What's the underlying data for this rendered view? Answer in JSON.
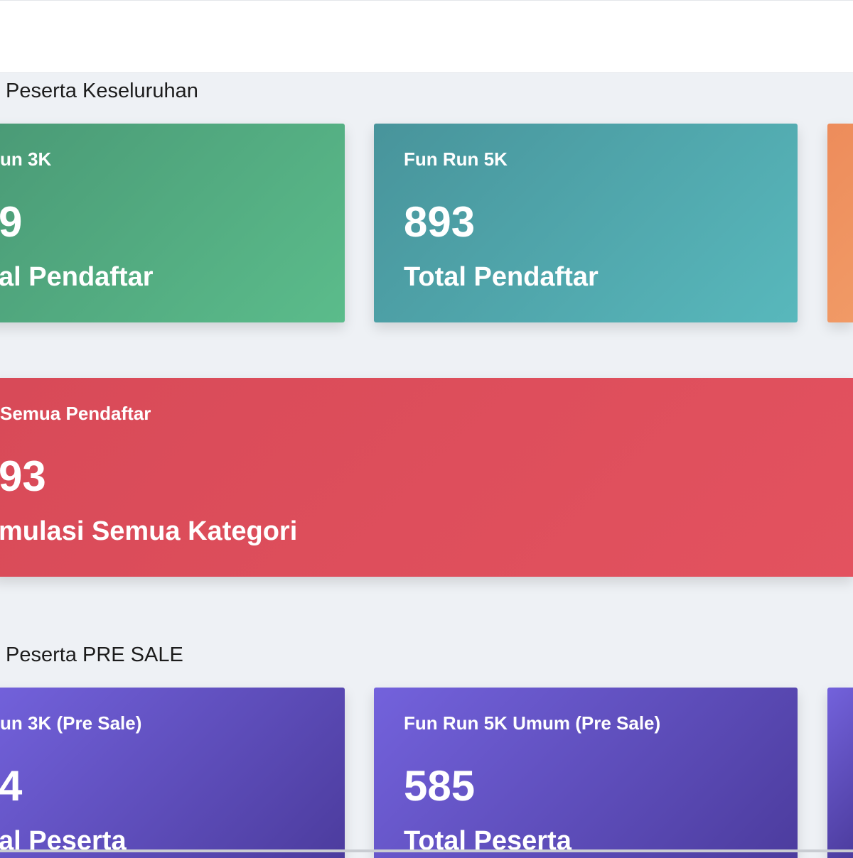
{
  "sections": {
    "overall_title": "Peserta Keseluruhan",
    "presale_title": "Peserta PRE SALE"
  },
  "overall_cards": [
    {
      "label": "un 3K",
      "value": "9",
      "desc": "al Pendaftar",
      "color": "#53ad80"
    },
    {
      "label": "Fun Run 5K",
      "value": "893",
      "desc": "Total Pendaftar",
      "color": "#50a6ab"
    },
    {
      "label": "",
      "value": "",
      "desc": "",
      "color": "#ef9360"
    }
  ],
  "total_card": {
    "label": "Semua Pendaftar",
    "value": "93",
    "desc": "mulasi Semua Kategori",
    "color": "#de4e5b"
  },
  "presale_cards": [
    {
      "label": "un 3K (Pre Sale)",
      "value": "4",
      "desc": "al Peserta",
      "color": "#5f4fc2"
    },
    {
      "label": "Fun Run 5K Umum (Pre Sale)",
      "value": "585",
      "desc": "Total Peserta",
      "color": "#5f4fc2"
    },
    {
      "label": "",
      "value": "",
      "desc": "",
      "color": "#6e5cd8"
    }
  ]
}
